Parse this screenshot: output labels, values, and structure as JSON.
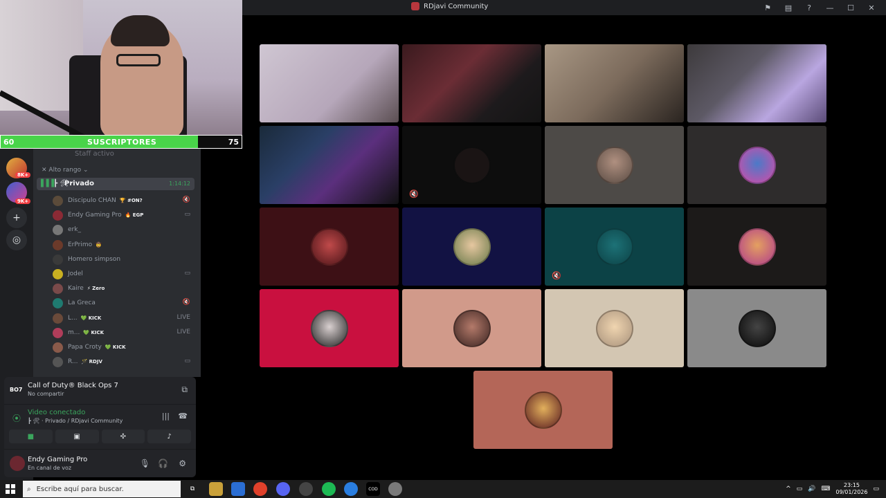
{
  "window": {
    "title": "RDjavi Community"
  },
  "overlay": {
    "subs_min": "60",
    "subs_label": "SUSCRIPTORES",
    "subs_max": "75",
    "subs_progress": 0.82
  },
  "rail": {
    "badges": [
      "8K+",
      "9K+"
    ]
  },
  "channel": {
    "above_label": "Staff activo",
    "category": "Alto rango",
    "voice_name": "Privado",
    "voice_prefix": "┣ 🛠 ·",
    "voice_time": "1:14:12",
    "members": [
      {
        "name": "Discipulo CHAN",
        "tag": "🏆 #ON?",
        "right": "🔇"
      },
      {
        "name": "Endy Gaming Pro",
        "tag": "🔥 EGP",
        "right": "▭"
      },
      {
        "name": "erk_",
        "tag": "",
        "right": ""
      },
      {
        "name": "ErPrimo",
        "tag": "🤠",
        "right": ""
      },
      {
        "name": "Homero simpson",
        "tag": "",
        "right": ""
      },
      {
        "name": "Jodel",
        "tag": "",
        "right": "▭"
      },
      {
        "name": "Kaire",
        "tag": "⚡ Zero",
        "right": ""
      },
      {
        "name": "La Greca",
        "tag": "",
        "right": "🔇"
      },
      {
        "name": "L...",
        "tag": "💚 KICK",
        "right": "LIVE"
      },
      {
        "name": "m...",
        "tag": "💚 KICK",
        "right": "LIVE"
      },
      {
        "name": "Papa Croty",
        "tag": "💚 KICK",
        "right": ""
      },
      {
        "name": "R...",
        "tag": "🪄 RDJV",
        "right": "▭"
      }
    ]
  },
  "panel": {
    "game_logo": "BO7",
    "game_title": "Call of Duty® Black Ops 7",
    "game_sub": "No compartir",
    "conn_title": "Video conectado",
    "conn_sub": "┣ 🛠 · Privado / RDjavi Community",
    "user_name": "Endy Gaming Pro",
    "user_status": "En canal de voz"
  },
  "taskbar": {
    "search_placeholder": "Escribe aquí para buscar.",
    "time": "23:15",
    "date": "09/01/2026"
  },
  "colors": {
    "accent_green": "#3ba55d",
    "sub_bar": "#49d44a",
    "danger": "#f23f43"
  }
}
